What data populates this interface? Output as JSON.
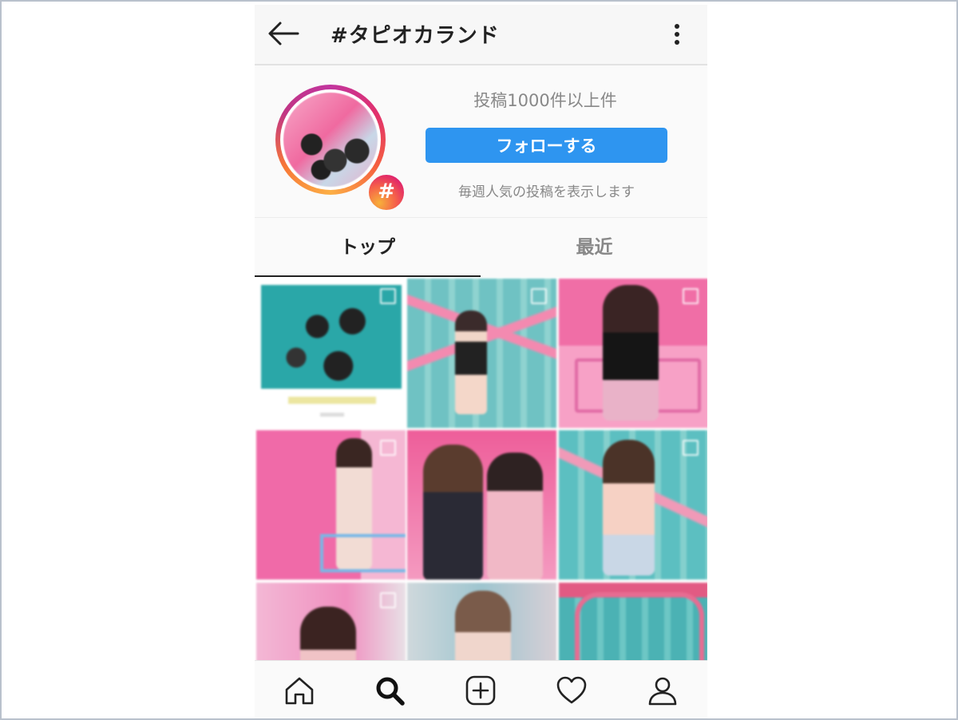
{
  "header": {
    "title": "#タピオカランド"
  },
  "profile": {
    "post_count": "投稿1000件以上件",
    "follow_label": "フォローする",
    "weekly_note": "毎週人気の投稿を表示します",
    "badge_symbol": "#"
  },
  "tabs": [
    {
      "label": "トップ",
      "active": true
    },
    {
      "label": "最近",
      "active": false
    }
  ],
  "grid": {
    "tile_count": 9
  },
  "bottom_nav": {
    "items": [
      "home-icon",
      "search-icon",
      "add-post-icon",
      "heart-icon",
      "profile-icon"
    ],
    "active": "search-icon"
  },
  "colors": {
    "follow_button": "#2e95f0",
    "gradient_ring": [
      "#c13584",
      "#e1306c",
      "#f56040",
      "#fcaf45"
    ]
  }
}
